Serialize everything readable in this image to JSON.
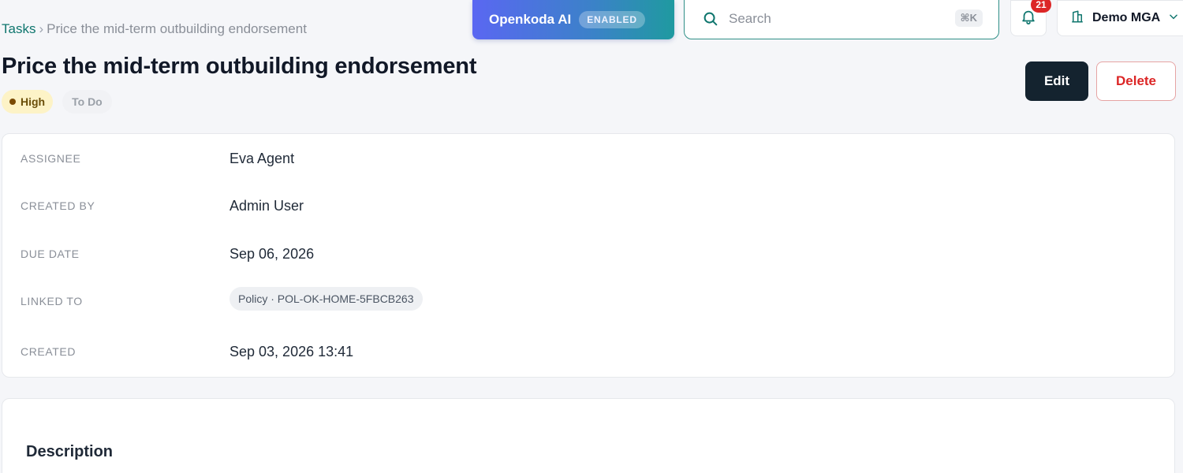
{
  "breadcrumb": {
    "root": "Tasks",
    "separator": "›",
    "current": "Price the mid-term outbuilding endorsement"
  },
  "task": {
    "title": "Price the mid-term outbuilding endorsement",
    "priority": "High",
    "status": "To Do"
  },
  "topbar": {
    "ai_label": "Openkoda AI",
    "ai_status": "ENABLED",
    "search_placeholder": "Search",
    "search_shortcut": "⌘K",
    "notification_count": "21",
    "org_name": "Demo MGA"
  },
  "actions": {
    "edit_label": "Edit",
    "delete_label": "Delete"
  },
  "details": [
    {
      "label": "ASSIGNEE",
      "value": "Eva Agent"
    },
    {
      "label": "CREATED BY",
      "value": "Admin User"
    },
    {
      "label": "DUE DATE",
      "value": "Sep 06, 2026"
    },
    {
      "label": "LINKED TO",
      "value": "Policy · POL-OK-HOME-5FBCB263"
    },
    {
      "label": "CREATED",
      "value": "Sep 03, 2026 13:41"
    }
  ],
  "description": {
    "title": "Description"
  },
  "colors": {
    "accent": "#0f766e",
    "primary_button": "#14232f",
    "danger": "#dc2626",
    "priority_bg": "#fdf3c7"
  },
  "icons": {
    "search": "search-icon",
    "bell": "bell-icon",
    "org": "building-icon",
    "dropdown": "chevron-down-icon"
  }
}
